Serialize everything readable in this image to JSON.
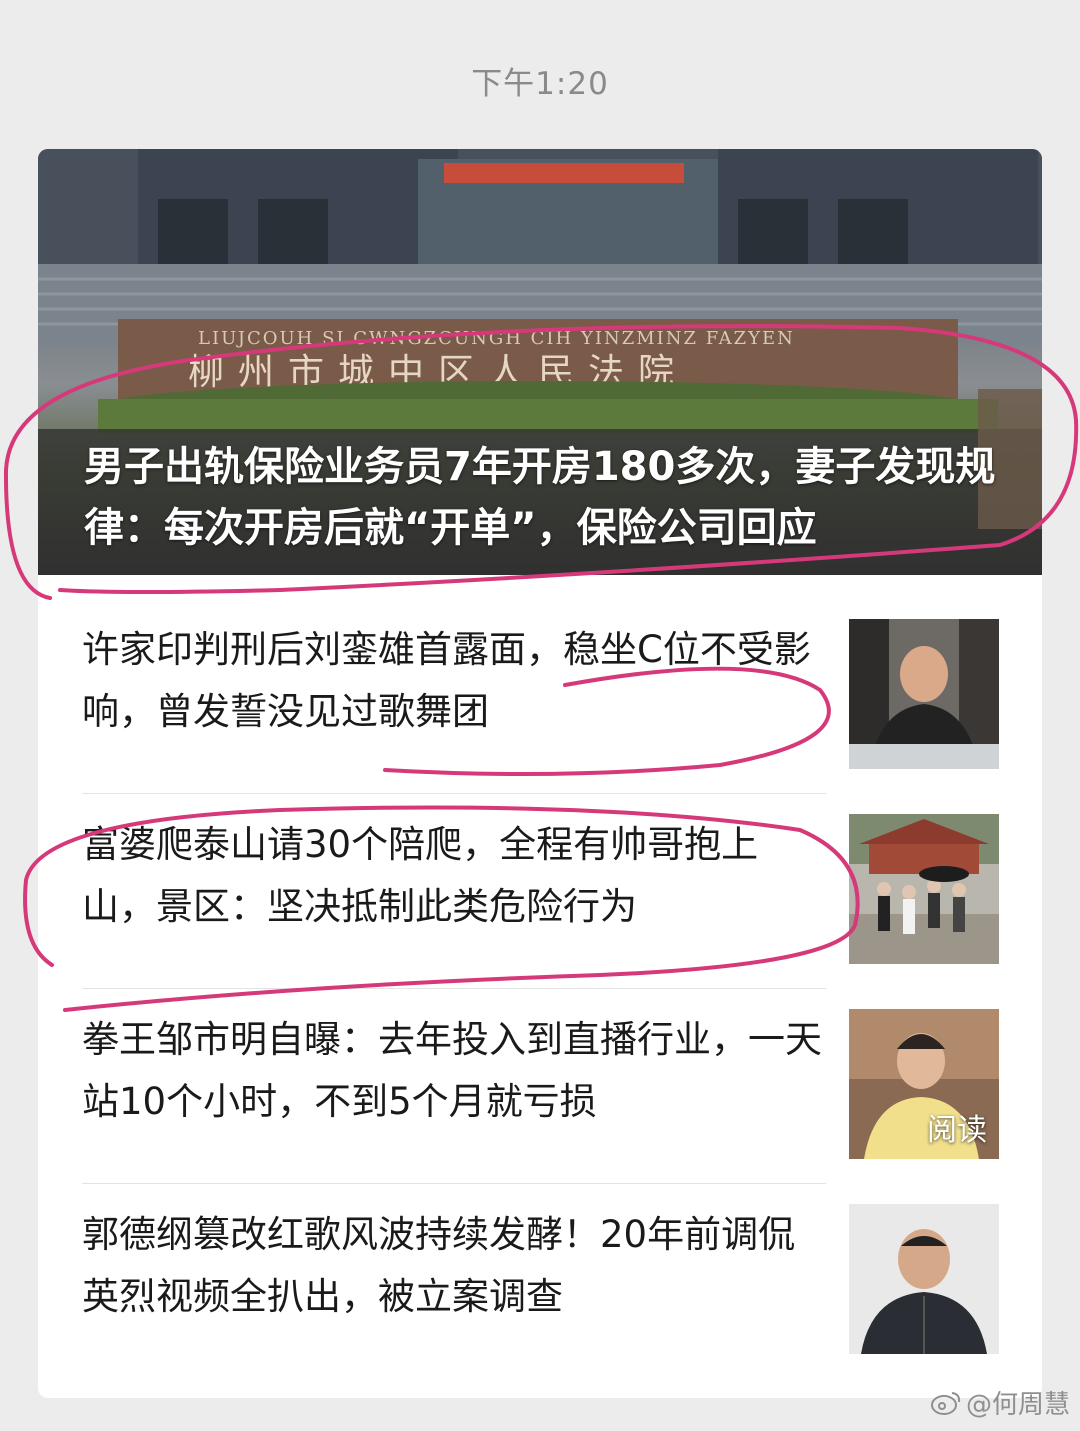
{
  "chat": {
    "timestamp": "下午1:20"
  },
  "card": {
    "hero": {
      "title": "男子出轨保险业务员7年开房180多次，妻子发现规律：每次开房后就“开单”，保险公司回应",
      "sign_pinyin": "LIUJCOUH SI CWNGZCUNGH CIH YINZMINZ FAZYEN",
      "sign_chinese": "柳州市城中区人民法院"
    },
    "articles": [
      {
        "title": "许家印判刑后刘銮雄首露面，稳坐C位不受影响，曾发誓没见过歌舞团",
        "thumb_badge": ""
      },
      {
        "title": "富婆爬泰山请30个陪爬，全程有帅哥抱上山，景区：坚决抵制此类危险行为",
        "thumb_badge": ""
      },
      {
        "title": "拳王邹市明自曝：去年投入到直播行业，一天站10个小时，不到5个月就亏损",
        "thumb_badge": "阅读"
      },
      {
        "title": "郭德纲篡改红歌风波持续发酵！20年前调侃英烈视频全扒出，被立案调查",
        "thumb_badge": ""
      }
    ]
  },
  "watermark": {
    "icon": "weibo-icon",
    "text": "@何周慧"
  },
  "colors": {
    "annotation": "#d6397a",
    "background": "#ececec"
  }
}
